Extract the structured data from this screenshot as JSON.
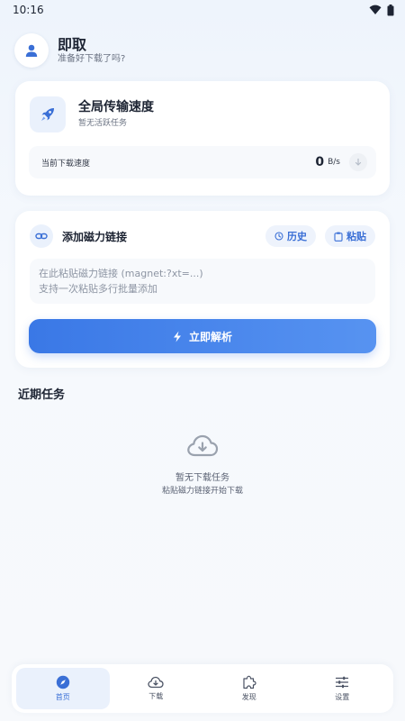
{
  "status": {
    "time": "10:16"
  },
  "header": {
    "app_name": "即取",
    "subtitle": "准备好下载了吗?"
  },
  "speed_card": {
    "title": "全局传输速度",
    "subtitle": "暂无活跃任务",
    "label": "当前下载速度",
    "value": "0",
    "unit": "B/s"
  },
  "magnet_card": {
    "title": "添加磁力链接",
    "history_label": "历史",
    "paste_label": "粘贴",
    "input_placeholder": "在此粘贴磁力链接 (magnet:?xt=...)\n支持一次粘贴多行批量添加",
    "input_value": "",
    "parse_label": "立即解析"
  },
  "recent": {
    "title": "近期任务",
    "empty_title": "暂无下载任务",
    "empty_sub": "粘贴磁力链接开始下载"
  },
  "nav": [
    {
      "label": "首页",
      "icon": "compass-icon",
      "active": true
    },
    {
      "label": "下载",
      "icon": "cloud-download-icon",
      "active": false
    },
    {
      "label": "发现",
      "icon": "puzzle-icon",
      "active": false
    },
    {
      "label": "设置",
      "icon": "sliders-icon",
      "active": false
    }
  ],
  "colors": {
    "accent": "#3a78e6",
    "accent_light": "#eaf1fc",
    "text": "#1d2433",
    "muted": "#6a7282"
  }
}
